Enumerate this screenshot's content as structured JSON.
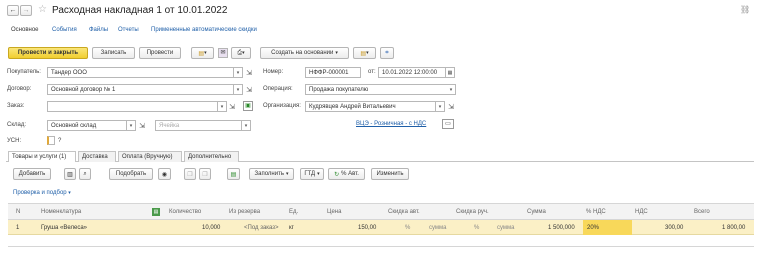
{
  "window": {
    "title": "Расходная накладная 1 от 10.01.2022"
  },
  "nav_tabs": [
    "Основное",
    "События",
    "Файлы",
    "Отчеты",
    "Примененные автоматические скидки"
  ],
  "toolbar": {
    "post_close": "Провести и закрыть",
    "save": "Записать",
    "post": "Провести",
    "create_based": "Создать на основании"
  },
  "form": {
    "buyer_label": "Покупатель:",
    "buyer_value": "Тандер ООО",
    "contract_label": "Договор:",
    "contract_value": "Основной договор № 1",
    "order_label": "Заказ:",
    "order_value": "",
    "warehouse_label": "Склад:",
    "warehouse_value": "Основной склад",
    "warehouse2_placeholder": "Ячейка",
    "usn_label": "УСН:",
    "usn_value": "?",
    "number_label": "Номер:",
    "number_value": "НФФР-000001",
    "from_label": "от:",
    "date_value": "10.01.2022 12:00:00",
    "operation_label": "Операция:",
    "operation_value": "Продажа покупателю",
    "org_label": "Организация:",
    "org_value": "Кудрявцев Андрей Витальевич",
    "prices_link": "ВЦЭ - Розничная - с НДС"
  },
  "doc_tabs": [
    "Товары и услуги (1)",
    "Доставка",
    "Оплата (Вручную)",
    "Дополнительно"
  ],
  "table_toolbar": {
    "add": "Добавить",
    "selection": "Подобрать",
    "fill": "Заполнить",
    "gtd": "ГТД",
    "percent_auto": "% Авт.",
    "change": "Изменить"
  },
  "check_link": "Проверка и подбор",
  "columns": [
    "N",
    "Номенклатура",
    "Количество",
    "Из резерва",
    "Ед.",
    "Цена",
    "Скидка авт.",
    "Скидка руч.",
    "Сумма",
    "% НДС",
    "НДС",
    "Всего"
  ],
  "rows": [
    {
      "n": "1",
      "item": "Груша «Велеса»",
      "qty": "10,000",
      "reserve": "<Под заказ>",
      "unit": "кг",
      "price": "150,00",
      "disc_auto_pct": "%",
      "disc_auto_sum": "сумма",
      "disc_man_pct": "%",
      "disc_man_sum": "сумма",
      "sum": "1 500,000",
      "vat_rate": "20%",
      "vat": "300,00",
      "total": "1 800,00"
    }
  ]
}
